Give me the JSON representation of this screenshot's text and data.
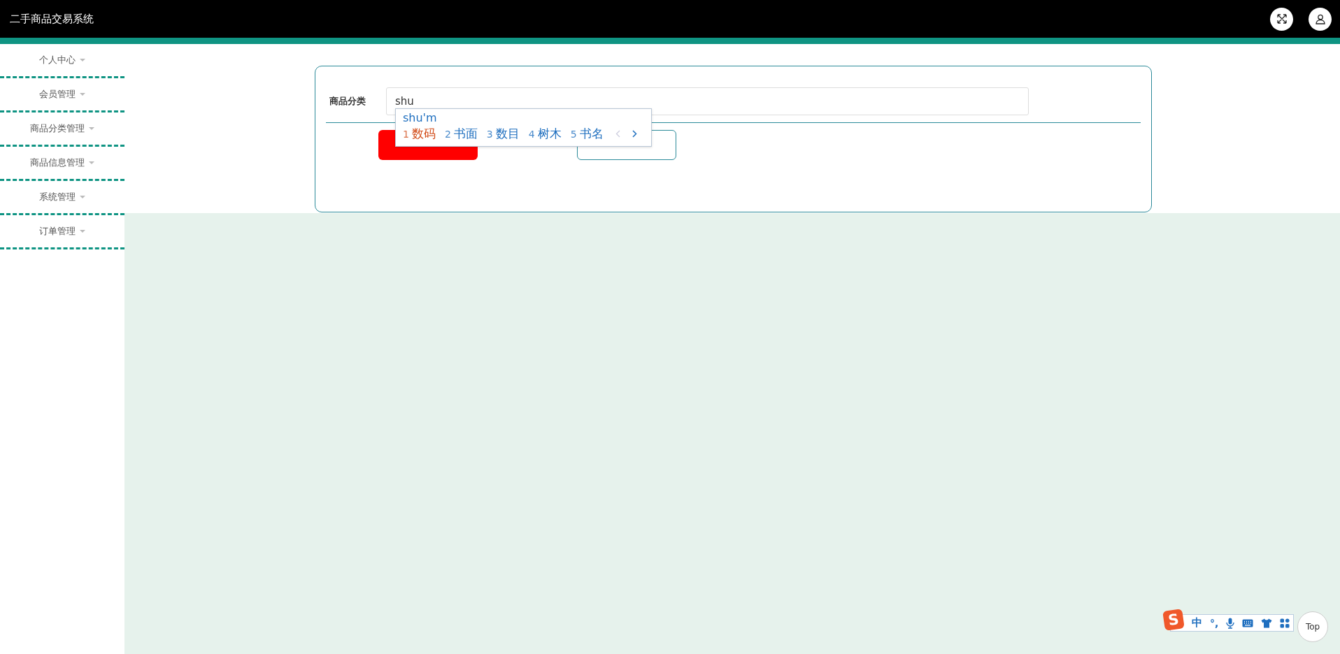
{
  "header": {
    "title": "二手商品交易系统"
  },
  "sidebar": {
    "items": [
      {
        "label": "个人中心"
      },
      {
        "label": "会员管理"
      },
      {
        "label": "商品分类管理"
      },
      {
        "label": "商品信息管理"
      },
      {
        "label": "系统管理"
      },
      {
        "label": "订单管理"
      }
    ]
  },
  "form": {
    "label": "商品分类",
    "value": "shu"
  },
  "ime": {
    "composition": "shu'm",
    "candidates": [
      {
        "index": "1",
        "text": "数码",
        "selected": true
      },
      {
        "index": "2",
        "text": "书面",
        "selected": false
      },
      {
        "index": "3",
        "text": "数目",
        "selected": false
      },
      {
        "index": "4",
        "text": "树木",
        "selected": false
      },
      {
        "index": "5",
        "text": "书名",
        "selected": false
      }
    ],
    "toolbar": {
      "logo": "S",
      "mode": "中",
      "punct": "°,"
    }
  },
  "back_to_top": "Top"
}
